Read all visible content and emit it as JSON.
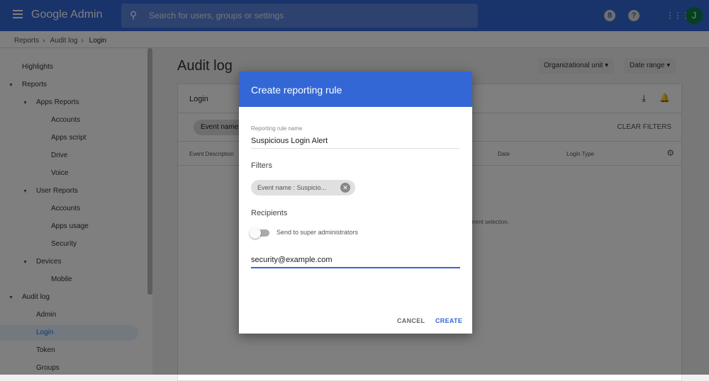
{
  "header": {
    "app_name": "Google Admin",
    "search_placeholder": "Search for users, groups or settings",
    "avatar_initial": "J",
    "hourglass": "8",
    "help": "?"
  },
  "breadcrumb": [
    "Reports",
    "Audit log",
    "Login"
  ],
  "sidebar": {
    "items": [
      {
        "label": "Highlights",
        "level": 0
      },
      {
        "label": "Reports",
        "level": 0,
        "expanded": true
      },
      {
        "label": "Apps Reports",
        "level": 1,
        "expanded": true
      },
      {
        "label": "Accounts",
        "level": 2
      },
      {
        "label": "Apps script",
        "level": 2
      },
      {
        "label": "Drive",
        "level": 2
      },
      {
        "label": "Voice",
        "level": 2
      },
      {
        "label": "User Reports",
        "level": 1,
        "expanded": true
      },
      {
        "label": "Accounts",
        "level": 2
      },
      {
        "label": "Apps usage",
        "level": 2
      },
      {
        "label": "Security",
        "level": 2
      },
      {
        "label": "Devices",
        "level": 1,
        "expanded": true
      },
      {
        "label": "Mobile",
        "level": 2
      },
      {
        "label": "Audit log",
        "level": 0,
        "expanded": true
      },
      {
        "label": "Admin",
        "level": 1
      },
      {
        "label": "Login",
        "level": 1,
        "selected": true
      },
      {
        "label": "Token",
        "level": 1
      },
      {
        "label": "Groups",
        "level": 1
      }
    ]
  },
  "main": {
    "title": "Audit log",
    "org_unit": "Organizational unit",
    "date_range": "Date range",
    "card_title": "Login",
    "chip": "Event name:",
    "clear_filters": "CLEAR FILTERS",
    "columns": [
      "Event Description",
      "Date",
      "Login Type"
    ],
    "empty_text": "urrent selection."
  },
  "dialog": {
    "title": "Create reporting rule",
    "name_label": "Reporting rule name",
    "name_value": "Suspicious Login Alert",
    "filters_label": "Filters",
    "filter_chip": "Event name : Suspicio...",
    "recipients_label": "Recipients",
    "toggle_label": "Send to super administrators",
    "toggle_on": false,
    "email_value": "security@example.com",
    "cancel": "CANCEL",
    "create": "CREATE"
  },
  "colors": {
    "accent": "#3367d6"
  }
}
